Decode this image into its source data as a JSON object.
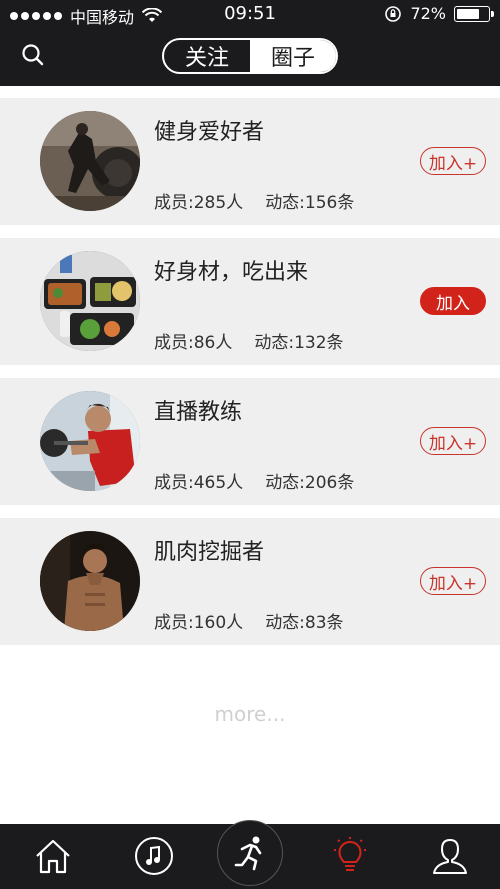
{
  "status_bar": {
    "carrier": "中国移动",
    "time": "09:51",
    "battery": "72%",
    "battery_level": 0.72
  },
  "nav": {
    "tabs": [
      {
        "label": "关注",
        "active": false
      },
      {
        "label": "圈子",
        "active": true
      }
    ]
  },
  "groups": [
    {
      "name": "健身爱好者",
      "members": "成员:285人",
      "posts": "动态:156条",
      "join_label": "加入+",
      "joined": false
    },
    {
      "name": "好身材，吃出来",
      "members": "成员:86人",
      "posts": "动态:132条",
      "join_label": "加入",
      "joined": true
    },
    {
      "name": "直播教练",
      "members": "成员:465人",
      "posts": "动态:206条",
      "join_label": "加入+",
      "joined": false
    },
    {
      "name": "肌肉挖掘者",
      "members": "成员:160人",
      "posts": "动态:83条",
      "join_label": "加入+",
      "joined": false
    }
  ],
  "more_text": "more...",
  "tabbar": {
    "items": [
      "home-icon",
      "music-icon",
      "run-icon",
      "bulb-icon",
      "user-icon"
    ],
    "active_color": "#d2231b"
  },
  "colors": {
    "header_bg": "#1b1b1d",
    "accent": "#c8332b",
    "row_bg": "#efefef"
  }
}
